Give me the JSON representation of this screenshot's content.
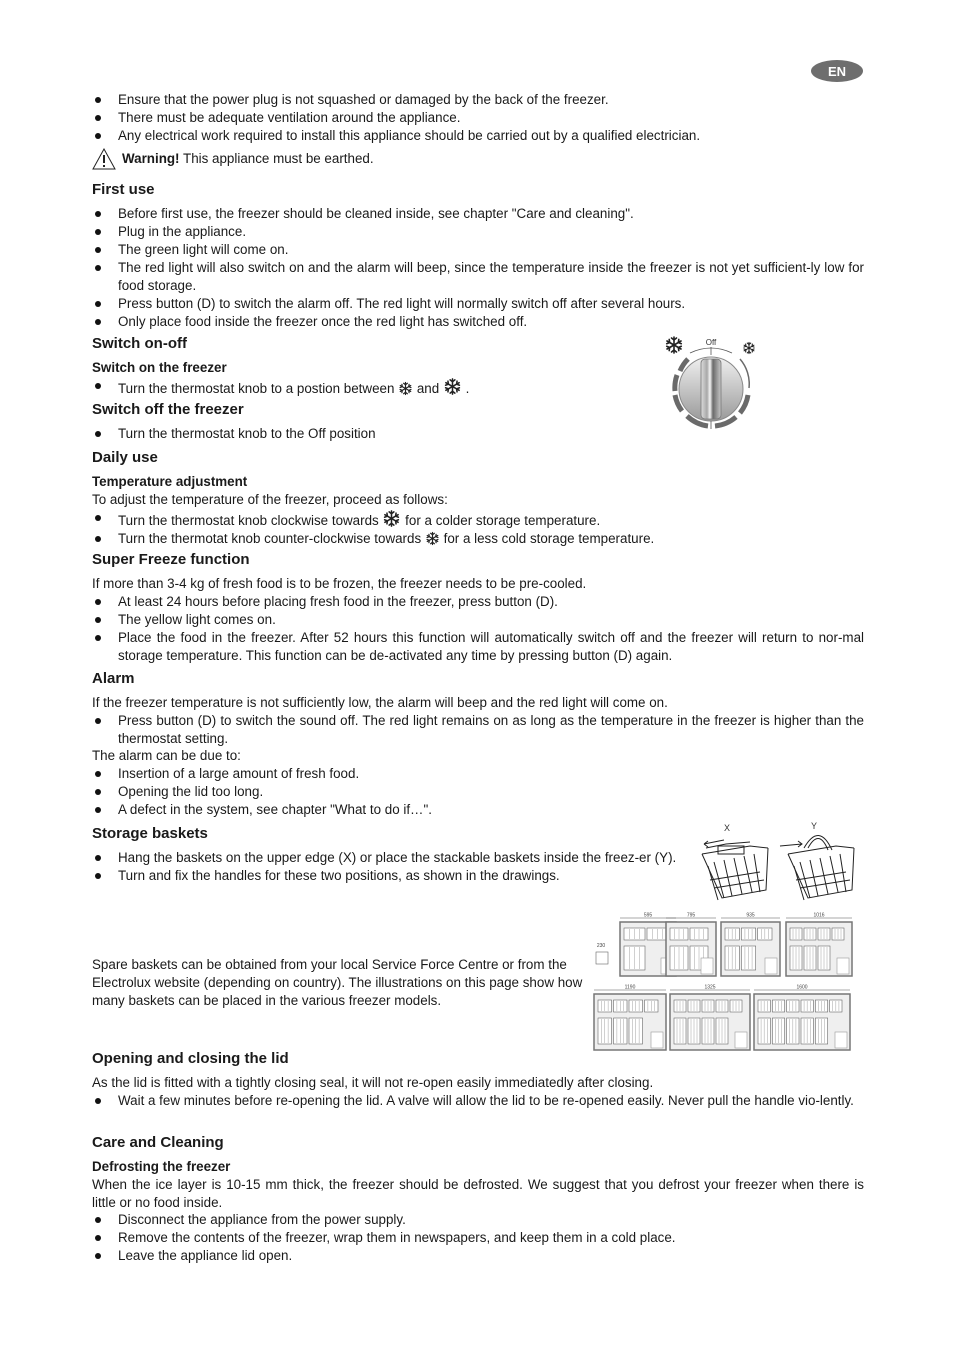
{
  "badge": {
    "lang": "EN"
  },
  "intro_bullets": [
    "Ensure that the power plug is not squashed or damaged by the back of the freezer.",
    "There must be adequate ventilation around the appliance.",
    "Any electrical work required to install this appliance should be carried out by a qualified electrician."
  ],
  "warning": {
    "label": "Warning!",
    "text": " This appliance must be earthed.",
    "icon": "warning-triangle-icon"
  },
  "first_use": {
    "title": "First use",
    "bullets": [
      "Before first use, the freezer should be cleaned inside, see chapter \"Care and cleaning\".",
      "Plug in the appliance.",
      "The green light will come on.",
      "The red light will also switch on and the alarm will beep, since the temperature inside the freezer is not yet sufficient-ly low for food storage.",
      "Press button (D) to switch the alarm off. The red light will normally switch off after several hours.",
      "Only place food inside the freezer once the red light has switched off."
    ]
  },
  "switch_onoff": {
    "title": "Switch on-off",
    "on_subtitle": "Switch on the freezer",
    "on_bullet_pre": "Turn the thermostat knob to a postion between ",
    "on_bullet_mid": " and ",
    "on_bullet_post": " .",
    "off_title": "Switch off the freezer",
    "off_bullet": "Turn the thermostat knob to the Off position",
    "knob_label": "Off"
  },
  "daily_use": {
    "title": "Daily use",
    "subtitle": "Temperature adjustment",
    "intro": "To adjust the temperature of the freezer, proceed as follows:",
    "b1_pre": "Turn the thermostat knob clockwise towards ",
    "b1_post": " for a colder storage temperature.",
    "b2_pre": "Turn the thermotat knob counter-clockwise towards ",
    "b2_post": " for a less cold storage temperature."
  },
  "super_freeze": {
    "title": "Super Freeze function",
    "intro": "If more than 3-4 kg of fresh food is to be frozen, the freezer needs to be pre-cooled.",
    "bullets": [
      "At least 24 hours before placing fresh food in the freezer, press button (D).",
      "The yellow light comes on.",
      "Place the food in the freezer. After 52 hours this function will automatically switch off and the freezer will return to nor-mal storage temperature. This function can be de-activated any time by pressing button (D) again."
    ]
  },
  "alarm": {
    "title": "Alarm",
    "intro": "If the freezer temperature is not sufficiently low, the alarm will beep and the red light will come on.",
    "bullet1": "Press button (D) to switch the sound off. The red light remains on as long as the temperature in the freezer is higher than the thermostat setting.",
    "due_to": "The alarm can be due to:",
    "causes": [
      "Insertion of a large amount of fresh food.",
      "Opening the lid too long.",
      "A defect in the system, see chapter \"What to do if…\"."
    ]
  },
  "storage_baskets": {
    "title": "Storage baskets",
    "bullets": [
      "Hang the baskets on the upper edge (X) or place the stackable baskets inside the freez-er (Y).",
      "Turn and fix the handles for these two positions, as shown in the drawings."
    ],
    "spare_text": "Spare baskets can be obtained from your local Service Force Centre or from the Electrolux website (depending on country). The illustrations on this page show how many baskets can be placed in the various freezer models.",
    "fig_labels": {
      "x": "X",
      "y": "Y"
    },
    "basket_width": "230",
    "models_row1": [
      "595",
      "795",
      "935",
      "1016"
    ],
    "models_row2": [
      "1190",
      "1325",
      "1600"
    ]
  },
  "lid": {
    "title": "Opening and closing the lid",
    "intro": "As the lid is fitted with a tightly closing seal, it will not re-open easily immediatedly after closing.",
    "bullet": "Wait a few minutes before re-opening the lid. A valve will allow the lid to be re-opened easily. Never pull the handle vio-lently."
  },
  "care": {
    "title": "Care and Cleaning",
    "subtitle": "Defrosting the freezer",
    "intro": "When the ice layer is 10-15 mm thick, the freezer should be defrosted. We suggest that you defrost your freezer when there is little or no food inside.",
    "bullets": [
      "Disconnect the appliance from the power supply.",
      "Remove the contents of the freezer, wrap them in newspapers, and keep them in a cold place.",
      "Leave the appliance lid open."
    ]
  }
}
